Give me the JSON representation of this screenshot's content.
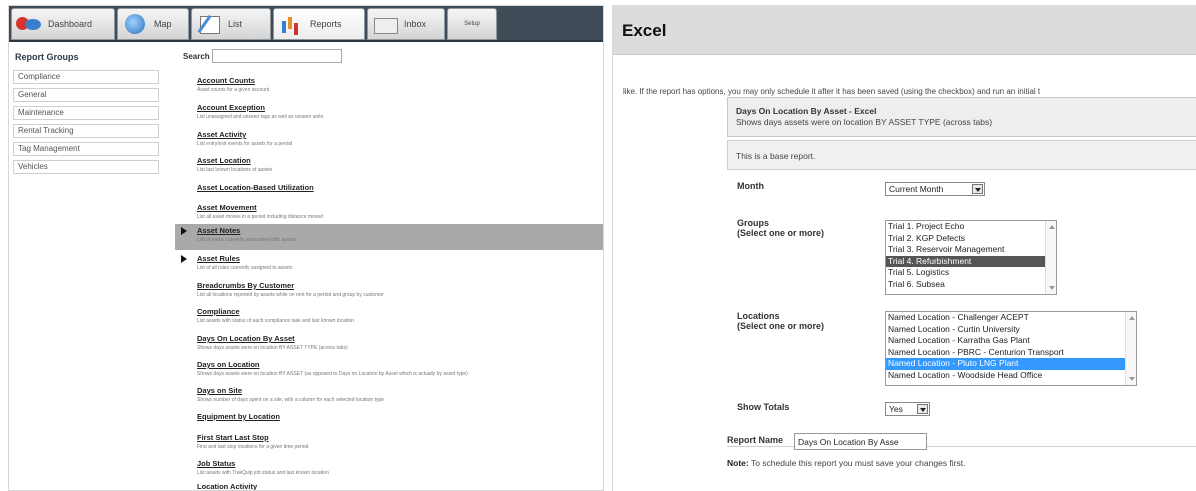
{
  "tabs": [
    {
      "label": "Dashboard",
      "icon": "dashboard-icon"
    },
    {
      "label": "Map",
      "icon": "map-globe-icon"
    },
    {
      "label": "List",
      "icon": "list-edit-icon"
    },
    {
      "label": "Reports",
      "icon": "reports-chart-icon"
    },
    {
      "label": "Inbox",
      "icon": "inbox-icon"
    },
    {
      "label": "Setup",
      "icon": ""
    }
  ],
  "sidebar": {
    "title": "Report Groups",
    "items": [
      "Compliance",
      "General",
      "Maintenance",
      "Rental Tracking",
      "Tag Management",
      "Vehicles"
    ]
  },
  "search": {
    "label": "Search",
    "value": ""
  },
  "reports": [
    {
      "title": "Account Counts",
      "desc": "Asset counts for a given account"
    },
    {
      "title": "Account Exception",
      "desc": "List unassigned and unseen tags as well as unseen units"
    },
    {
      "title": "Asset Activity",
      "desc": "List entry/exit events for assets for a period"
    },
    {
      "title": "Asset Location",
      "desc": "List last known locations of assets"
    },
    {
      "title": "Asset Location-Based Utilization",
      "desc": ""
    },
    {
      "title": "Asset Movement",
      "desc": "List all asset moves in a period including distance moved"
    },
    {
      "title": "Asset Notes",
      "desc": "List of notes currently associated with assets",
      "selected": true,
      "arrow": true
    },
    {
      "title": "Asset Rules",
      "desc": "List of all rules currently assigned to assets",
      "arrow": true
    },
    {
      "title": "Breadcrumbs By Customer",
      "desc": "List all locations reported by assets while on rent for a period and group by customer"
    },
    {
      "title": "Compliance",
      "desc": "List assets with status of each compliance task and last known location"
    },
    {
      "title": "Days On Location By Asset",
      "desc": "Shows days assets were on location BY ASSET TYPE (across tabs)"
    },
    {
      "title": "Days on Location",
      "desc": "Shows days assets were on location BY ASSET (as opposed to Days on Location by Asset which is actually by asset type)"
    },
    {
      "title": "Days on Site",
      "desc": "Shows number of days spent on a site, with a column for each selected location type"
    },
    {
      "title": "Equipment by Location",
      "desc": ""
    },
    {
      "title": "First Start Last Stop",
      "desc": "First and last stop locations for a given time period"
    },
    {
      "title": "Job Status",
      "desc": "List assets with TrakQuip job status and last known location"
    },
    {
      "title": "Location Activity",
      "desc": ""
    }
  ],
  "excel": {
    "title": "Excel",
    "intro": "like. If the report has options, you may only schedule it after it has been saved (using the checkbox) and run an initial t",
    "report_title": "Days On Location By Asset - Excel",
    "report_desc": "Shows days assets were on location BY ASSET TYPE (across tabs)",
    "base_note": "This is a base report.",
    "month": {
      "label": "Month",
      "value": "Current Month"
    },
    "groups": {
      "label": "Groups",
      "sub": "(Select one or more)",
      "options": [
        "Trial 1. Project Echo",
        "Trial 2. KGP Defects",
        "Trial 3. Reservoir Management",
        "Trial 4. Refurbishment",
        "Trial 5. Logistics",
        "Trial 6. Subsea"
      ],
      "selected_index": 3
    },
    "locations": {
      "label": "Locations",
      "sub": "(Select one or more)",
      "options": [
        "Named Location - Challenger ACEPT",
        "Named Location - Curtin University",
        "Named Location - Karratha Gas Plant",
        "Named Location - PBRC - Centurion Transport",
        "Named Location - Pluto LNG Plant",
        "Named Location - Woodside Head Office"
      ],
      "selected_index": 4
    },
    "totals": {
      "label": "Show Totals",
      "value": "Yes"
    },
    "report_name": {
      "label": "Report Name",
      "value": "Days On Location By Asse"
    },
    "note": {
      "bold": "Note:",
      "text": "To schedule this report you must save your changes first."
    }
  }
}
